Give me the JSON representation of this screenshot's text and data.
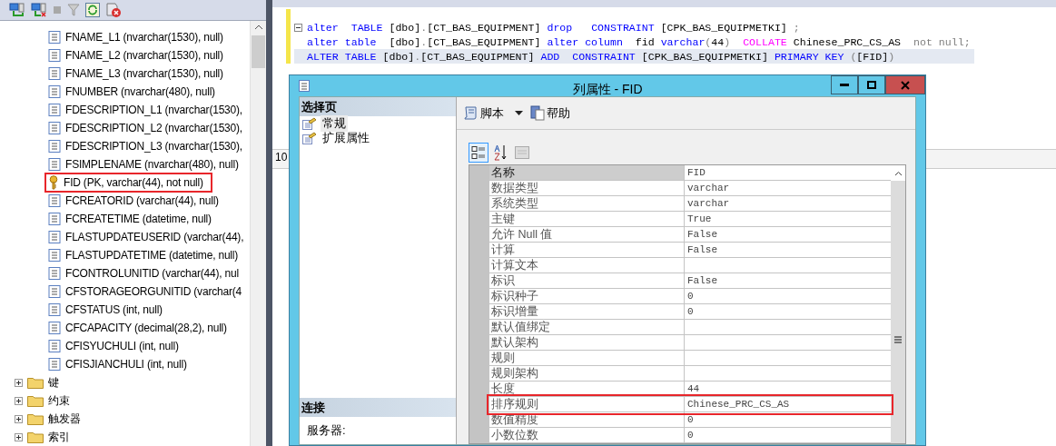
{
  "object_explorer": {
    "columns": [
      {
        "label": "FNAME_L1 (nvarchar(1530), null)",
        "kind": "column",
        "highlighted": false
      },
      {
        "label": "FNAME_L2 (nvarchar(1530), null)",
        "kind": "column",
        "highlighted": false
      },
      {
        "label": "FNAME_L3 (nvarchar(1530), null)",
        "kind": "column",
        "highlighted": false
      },
      {
        "label": "FNUMBER (nvarchar(480), null)",
        "kind": "column",
        "highlighted": false
      },
      {
        "label": "FDESCRIPTION_L1 (nvarchar(1530),",
        "kind": "column",
        "highlighted": false
      },
      {
        "label": "FDESCRIPTION_L2 (nvarchar(1530),",
        "kind": "column",
        "highlighted": false
      },
      {
        "label": "FDESCRIPTION_L3 (nvarchar(1530),",
        "kind": "column",
        "highlighted": false
      },
      {
        "label": "FSIMPLENAME (nvarchar(480), null)",
        "kind": "column",
        "highlighted": false
      },
      {
        "label": "FID (PK, varchar(44), not null)",
        "kind": "key",
        "highlighted": true
      },
      {
        "label": "FCREATORID (varchar(44), null)",
        "kind": "column",
        "highlighted": false
      },
      {
        "label": "FCREATETIME (datetime, null)",
        "kind": "column",
        "highlighted": false
      },
      {
        "label": "FLASTUPDATEUSERID (varchar(44),",
        "kind": "column",
        "highlighted": false
      },
      {
        "label": "FLASTUPDATETIME (datetime, null)",
        "kind": "column",
        "highlighted": false
      },
      {
        "label": "FCONTROLUNITID (varchar(44), nul",
        "kind": "column",
        "highlighted": false
      },
      {
        "label": "CFSTORAGEORGUNITID (varchar(4",
        "kind": "column",
        "highlighted": false
      },
      {
        "label": "CFSTATUS (int, null)",
        "kind": "column",
        "highlighted": false
      },
      {
        "label": "CFCAPACITY (decimal(28,2), null)",
        "kind": "column",
        "highlighted": false
      },
      {
        "label": "CFISYUCHULI (int, null)",
        "kind": "column",
        "highlighted": false
      },
      {
        "label": "CFISJIANCHULI (int, null)",
        "kind": "column",
        "highlighted": false
      }
    ],
    "folders": [
      {
        "label": "键",
        "expanded": false
      },
      {
        "label": "约束",
        "expanded": false
      },
      {
        "label": "触发器",
        "expanded": false
      },
      {
        "label": "索引",
        "expanded": false
      }
    ]
  },
  "editor": {
    "zoom": "10",
    "code_lines": [
      {
        "collapsible": true,
        "selected": false,
        "tokens": [
          {
            "kind": "keyword",
            "text": "alter  "
          },
          {
            "kind": "keyword",
            "text": "TABLE"
          },
          {
            "kind": "plain",
            "text": " [dbo]"
          },
          {
            "kind": "punct",
            "text": "."
          },
          {
            "kind": "plain",
            "text": "[CT_BAS_EQUIPMENT] "
          },
          {
            "kind": "keyword",
            "text": "drop   "
          },
          {
            "kind": "keyword",
            "text": "CONSTRAINT"
          },
          {
            "kind": "plain",
            "text": " [CPK_BAS_EQUIPMETKI] "
          },
          {
            "kind": "punct",
            "text": ";"
          }
        ]
      },
      {
        "collapsible": false,
        "selected": false,
        "tokens": [
          {
            "kind": "keyword",
            "text": "alter table"
          },
          {
            "kind": "plain",
            "text": "  [dbo]"
          },
          {
            "kind": "punct",
            "text": "."
          },
          {
            "kind": "plain",
            "text": "[CT_BAS_EQUIPMENT] "
          },
          {
            "kind": "keyword",
            "text": "alter column"
          },
          {
            "kind": "plain",
            "text": "  fid "
          },
          {
            "kind": "keyword",
            "text": "varchar"
          },
          {
            "kind": "punct",
            "text": "("
          },
          {
            "kind": "plain",
            "text": "44"
          },
          {
            "kind": "punct",
            "text": ")  "
          },
          {
            "kind": "function",
            "text": "COLLATE"
          },
          {
            "kind": "plain",
            "text": " Chinese_PRC_CS_AS  "
          },
          {
            "kind": "punct",
            "text": "not null;"
          }
        ]
      },
      {
        "collapsible": false,
        "selected": true,
        "tokens": [
          {
            "kind": "keyword",
            "text": "ALTER TABLE"
          },
          {
            "kind": "plain",
            "text": " [dbo]"
          },
          {
            "kind": "punct",
            "text": "."
          },
          {
            "kind": "plain",
            "text": "[CT_BAS_EQUIPMENT] "
          },
          {
            "kind": "keyword",
            "text": "ADD  "
          },
          {
            "kind": "keyword",
            "text": "CONSTRAINT"
          },
          {
            "kind": "plain",
            "text": " [CPK_BAS_EQUIPMETKI] "
          },
          {
            "kind": "keyword",
            "text": "PRIMARY KEY "
          },
          {
            "kind": "punct",
            "text": "("
          },
          {
            "kind": "plain",
            "text": "[FID]"
          },
          {
            "kind": "punct",
            "text": ")"
          }
        ]
      }
    ]
  },
  "dialog": {
    "title": "列属性 - FID",
    "select_page": {
      "header": "选择页",
      "pages": [
        {
          "label": "常规",
          "selected": true
        },
        {
          "label": "扩展属性",
          "selected": false
        }
      ]
    },
    "connection": {
      "header": "连接",
      "server_label": "服务器:"
    },
    "toolbar": [
      {
        "label": "脚本",
        "kind": "script"
      },
      {
        "label": "帮助",
        "kind": "help"
      }
    ],
    "grid": {
      "rows": [
        {
          "name": "名称",
          "value": "FID",
          "selected": true,
          "highlighted": false
        },
        {
          "name": "数据类型",
          "value": "varchar",
          "selected": false,
          "highlighted": false
        },
        {
          "name": "系统类型",
          "value": "varchar",
          "selected": false,
          "highlighted": false
        },
        {
          "name": "主键",
          "value": "True",
          "selected": false,
          "highlighted": false
        },
        {
          "name": "允许 Null 值",
          "value": "False",
          "selected": false,
          "highlighted": false
        },
        {
          "name": "计算",
          "value": "False",
          "selected": false,
          "highlighted": false
        },
        {
          "name": "计算文本",
          "selected": false,
          "highlighted": false
        },
        {
          "name": "标识",
          "value": "False",
          "selected": false,
          "highlighted": false
        },
        {
          "name": "标识种子",
          "value": "0",
          "selected": false,
          "highlighted": false
        },
        {
          "name": "标识增量",
          "value": "0",
          "selected": false,
          "highlighted": false
        },
        {
          "name": "默认值绑定",
          "selected": false,
          "highlighted": false
        },
        {
          "name": "默认架构",
          "selected": false,
          "highlighted": false
        },
        {
          "name": "规则",
          "selected": false,
          "highlighted": false
        },
        {
          "name": "规则架构",
          "selected": false,
          "highlighted": false
        },
        {
          "name": "长度",
          "value": "44",
          "selected": false,
          "highlighted": false
        },
        {
          "name": "排序规则",
          "value": "Chinese_PRC_CS_AS",
          "selected": false,
          "highlighted": true
        },
        {
          "name": "数值精度",
          "value": "0",
          "selected": false,
          "highlighted": false
        },
        {
          "name": "小数位数",
          "value": "0",
          "selected": false,
          "highlighted": false
        }
      ]
    }
  }
}
